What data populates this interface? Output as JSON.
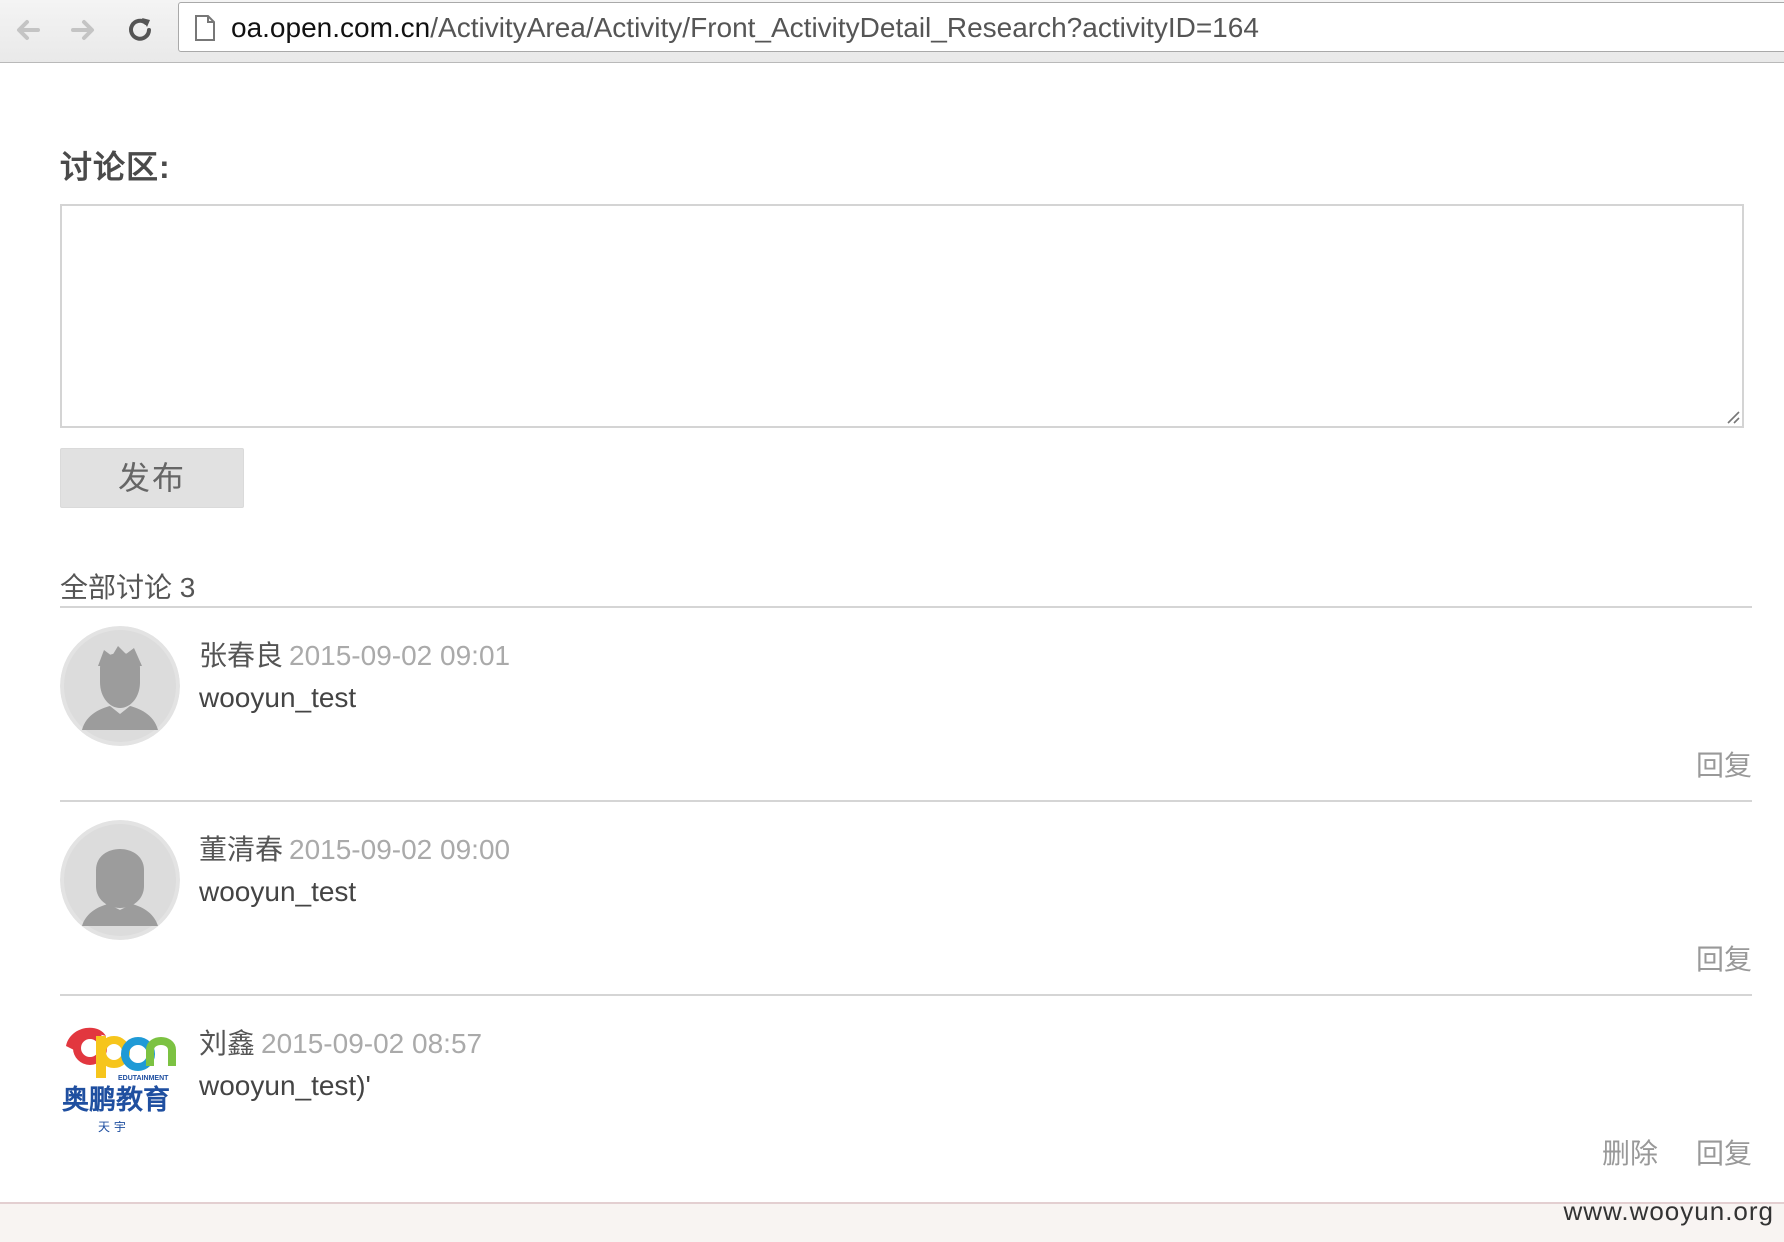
{
  "browser": {
    "url_host": "oa.open.com.cn",
    "url_path": "/ActivityArea/Activity/Front_ActivityDetail_Research?activityID=164"
  },
  "discussion": {
    "title": "讨论区:",
    "textarea_value": "",
    "publish_label": "发布",
    "count_title": "全部讨论 3"
  },
  "comments": [
    {
      "author": "张春良",
      "time": "2015-09-02 09:01",
      "body": "wooyun_test",
      "reply_label": "回复",
      "avatar": "male-avatar-icon"
    },
    {
      "author": "董清春",
      "time": "2015-09-02 09:00",
      "body": "wooyun_test",
      "reply_label": "回复",
      "avatar": "female-avatar-icon"
    },
    {
      "author": "刘鑫",
      "time": "2015-09-02 08:57",
      "body": "wooyun_test)'",
      "delete_label": "删除",
      "reply_label": "回复",
      "avatar": "open-edutainment-logo"
    }
  ],
  "logo": {
    "brand": "open",
    "tagline": "EDUTAINMENT",
    "name": "奥鹏教育",
    "sub": "天 宇"
  },
  "watermark": "www.wooyun.org",
  "colors": {
    "avatar_bg": "#e3e3e3",
    "avatar_figure": "#9c9c9c",
    "logo_blue": "#1f4fa0",
    "logo_red": "#e2373f",
    "logo_yellow": "#f6c51c",
    "logo_green": "#7cc242"
  }
}
